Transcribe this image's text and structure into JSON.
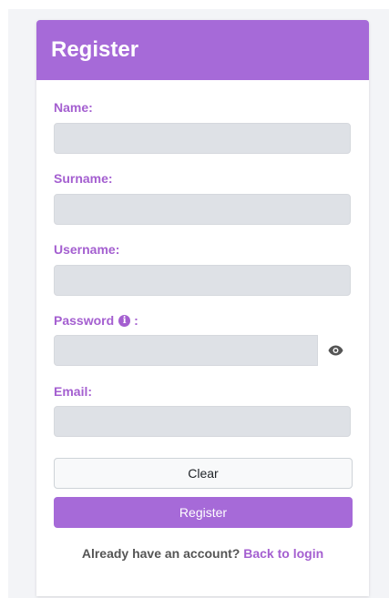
{
  "header": {
    "title": "Register"
  },
  "form": {
    "name": {
      "label": "Name:",
      "value": ""
    },
    "surname": {
      "label": "Surname:",
      "value": ""
    },
    "username": {
      "label": "Username:",
      "value": ""
    },
    "password": {
      "label": "Password",
      "suffix": ":",
      "value": "",
      "info_icon": "info-circle-icon",
      "toggle_icon": "eye-icon"
    },
    "email": {
      "label": "Email:",
      "value": ""
    }
  },
  "buttons": {
    "clear": "Clear",
    "register": "Register"
  },
  "footer": {
    "prompt": "Already have an account?",
    "link": "Back to login"
  },
  "colors": {
    "accent": "#a66ad8",
    "label": "#a45fd0",
    "input_bg": "#dee1e6"
  }
}
